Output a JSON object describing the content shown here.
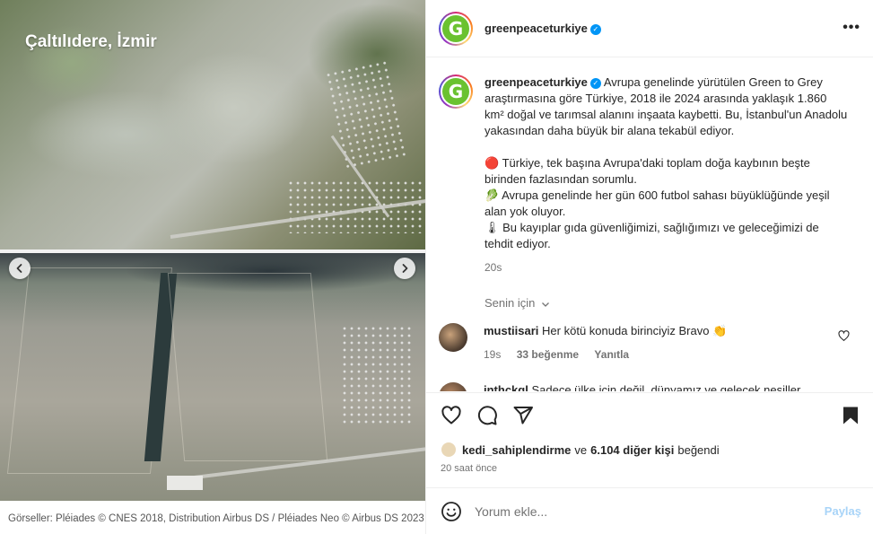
{
  "media": {
    "location_title": "Çaltılıdere, İzmir",
    "credit": "Görseller: Pléiades © CNES 2018, Distribution Airbus DS / Pléiades Neo © Airbus DS 2023",
    "prev_icon": "chevron-left-icon",
    "next_icon": "chevron-right-icon"
  },
  "header": {
    "username": "greenpeaceturkiye",
    "avatar_letter": "G",
    "verified_icon": "verified-badge-icon",
    "more_icon": "•••"
  },
  "caption": {
    "username": "greenpeaceturkiye",
    "avatar_letter": "G",
    "paragraph1": "Avrupa genelinde yürütülen Green to Grey araştırmasına göre Türkiye, 2018 ile 2024 arasında yaklaşık 1.860 km² doğal ve tarımsal alanını inşaata kaybetti. Bu, İstanbul'un Anadolu yakasından daha büyük bir alana tekabül ediyor.",
    "point1": "🔴 Türkiye, tek başına Avrupa'daki toplam doğa kaybının beşte birinden fazlasından sorumlu.",
    "point2": "🥬 Avrupa genelinde her gün 600 futbol sahası büyüklüğünde yeşil alan yok oluyor.",
    "point3": "🌡 Bu kayıplar gıda güvenliğimizi, sağlığımızı ve geleceğimizi de tehdit ediyor.",
    "time": "20s",
    "see_more": "Senin için"
  },
  "comments": [
    {
      "username": "mustiisari",
      "text": "Her kötü konuda birinciyiz Bravo 👏",
      "time": "19s",
      "likes": "33 beğenme",
      "reply": "Yanıtla"
    },
    {
      "username": "inthckgl",
      "text": "Sadece ülke için değil, dünyamız ve gelecek nesiller"
    }
  ],
  "actions": {
    "like_icon": "heart-icon",
    "comment_icon": "comment-icon",
    "share_icon": "share-icon",
    "save_icon": "bookmark-icon",
    "liked_by_user": "kedi_sahiplendirme",
    "liked_by_conj": "ve",
    "liked_by_others": "6.104 diğer kişi",
    "liked_by_suffix": "beğendi",
    "post_time": "20 saat önce"
  },
  "add_comment": {
    "emoji_icon": "emoji-icon",
    "placeholder": "Yorum ekle...",
    "post_label": "Paylaş"
  },
  "colors": {
    "verified": "#0095f6",
    "link_disabled": "#a8d4f8",
    "avatar_green": "#6ac230"
  }
}
